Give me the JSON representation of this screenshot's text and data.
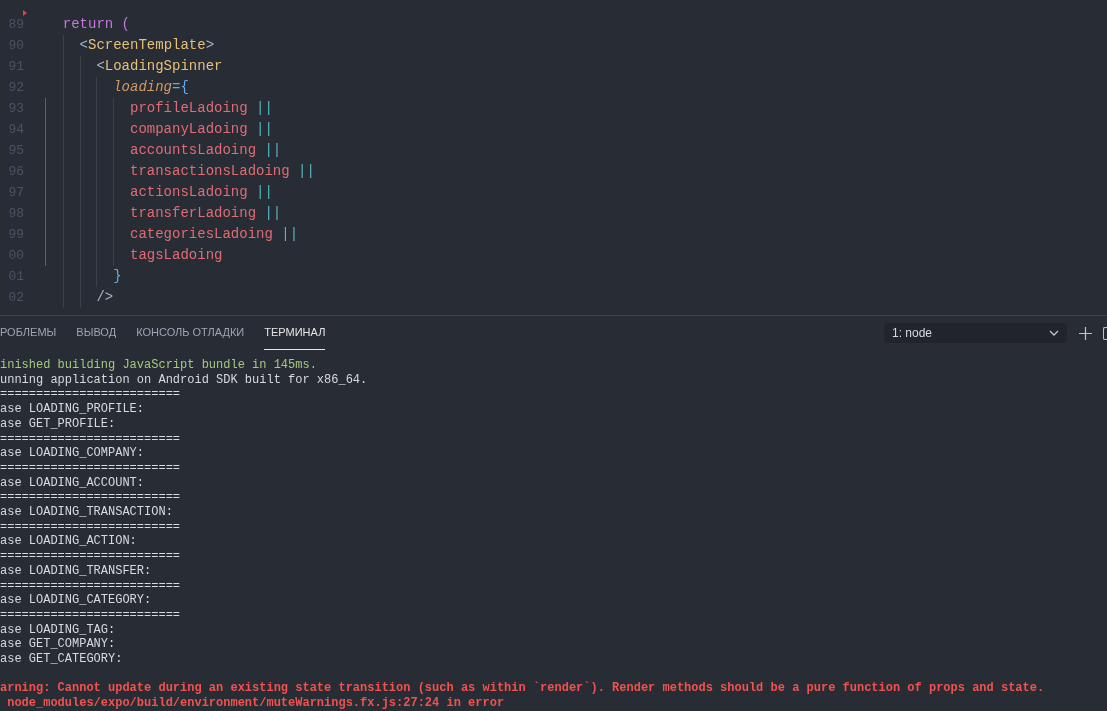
{
  "editor": {
    "fold_marker": true,
    "lines": [
      {
        "number": "89",
        "changed": false,
        "tokens": [
          {
            "text": "  return",
            "kind": "keyword"
          },
          {
            "text": " (",
            "kind": "paren"
          }
        ]
      },
      {
        "number": "90",
        "changed": false,
        "tokens": [
          {
            "text": "    <",
            "kind": "punct"
          },
          {
            "text": "ScreenTemplate",
            "kind": "tag"
          },
          {
            "text": ">",
            "kind": "punct"
          }
        ]
      },
      {
        "number": "91",
        "changed": false,
        "tokens": [
          {
            "text": "      <",
            "kind": "punct"
          },
          {
            "text": "LoadingSpinner",
            "kind": "tag"
          }
        ]
      },
      {
        "number": "92",
        "changed": false,
        "tokens": [
          {
            "text": "        loading",
            "kind": "attr"
          },
          {
            "text": "=",
            "kind": "operator"
          },
          {
            "text": "{",
            "kind": "brace"
          }
        ]
      },
      {
        "number": "93",
        "changed": true,
        "tokens": [
          {
            "text": "          profileLadoing",
            "kind": "ident"
          },
          {
            "text": " ||",
            "kind": "operator"
          }
        ]
      },
      {
        "number": "94",
        "changed": true,
        "tokens": [
          {
            "text": "          companyLadoing",
            "kind": "ident"
          },
          {
            "text": " ||",
            "kind": "operator"
          }
        ]
      },
      {
        "number": "95",
        "changed": true,
        "tokens": [
          {
            "text": "          accountsLadoing",
            "kind": "ident"
          },
          {
            "text": " ||",
            "kind": "operator"
          }
        ]
      },
      {
        "number": "96",
        "changed": true,
        "tokens": [
          {
            "text": "          transactionsLadoing",
            "kind": "ident"
          },
          {
            "text": " ||",
            "kind": "operator"
          }
        ]
      },
      {
        "number": "97",
        "changed": true,
        "tokens": [
          {
            "text": "          actionsLadoing",
            "kind": "ident"
          },
          {
            "text": " ||",
            "kind": "operator"
          }
        ]
      },
      {
        "number": "98",
        "changed": true,
        "tokens": [
          {
            "text": "          transferLadoing",
            "kind": "ident"
          },
          {
            "text": " ||",
            "kind": "operator"
          }
        ]
      },
      {
        "number": "99",
        "changed": true,
        "tokens": [
          {
            "text": "          categoriesLadoing",
            "kind": "ident"
          },
          {
            "text": " ||",
            "kind": "operator"
          }
        ]
      },
      {
        "number": "00",
        "changed": true,
        "tokens": [
          {
            "text": "          tagsLadoing",
            "kind": "ident"
          }
        ]
      },
      {
        "number": "01",
        "changed": false,
        "tokens": [
          {
            "text": "        }",
            "kind": "brace"
          }
        ]
      },
      {
        "number": "02",
        "changed": false,
        "tokens": [
          {
            "text": "      />",
            "kind": "punct"
          }
        ]
      }
    ]
  },
  "panel": {
    "tabs": [
      {
        "label": "РОБЛЕМЫ",
        "selected": false
      },
      {
        "label": "ВЫВОД",
        "selected": false
      },
      {
        "label": "КОНСОЛЬ ОТЛАДКИ",
        "selected": false
      },
      {
        "label": "ТЕРМИНАЛ",
        "selected": true
      }
    ],
    "terminal_select": {
      "value": "1: node"
    }
  },
  "terminal": {
    "lines": [
      {
        "text": "inished building JavaScript bundle in 145ms.",
        "kind": "success"
      },
      {
        "text": "unning application on Android SDK built for x86_64.",
        "kind": "normal"
      },
      {
        "text": "=========================",
        "kind": "normal"
      },
      {
        "text": "ase LOADING_PROFILE:",
        "kind": "normal"
      },
      {
        "text": "ase GET_PROFILE:",
        "kind": "normal"
      },
      {
        "text": "=========================",
        "kind": "normal"
      },
      {
        "text": "ase LOADING_COMPANY:",
        "kind": "normal"
      },
      {
        "text": "=========================",
        "kind": "normal"
      },
      {
        "text": "ase LOADING_ACCOUNT:",
        "kind": "normal"
      },
      {
        "text": "=========================",
        "kind": "normal"
      },
      {
        "text": "ase LOADING_TRANSACTION:",
        "kind": "normal"
      },
      {
        "text": "=========================",
        "kind": "normal"
      },
      {
        "text": "ase LOADING_ACTION:",
        "kind": "normal"
      },
      {
        "text": "=========================",
        "kind": "normal"
      },
      {
        "text": "ase LOADING_TRANSFER:",
        "kind": "normal"
      },
      {
        "text": "=========================",
        "kind": "normal"
      },
      {
        "text": "ase LOADING_CATEGORY:",
        "kind": "normal"
      },
      {
        "text": "=========================",
        "kind": "normal"
      },
      {
        "text": "ase LOADING_TAG:",
        "kind": "normal"
      },
      {
        "text": "ase GET_COMPANY:",
        "kind": "normal"
      },
      {
        "text": "ase GET_CATEGORY:",
        "kind": "normal"
      },
      {
        "text": "arning: Cannot update during an existing state transition (such as within `render`). Render methods should be a pure function of props and state.",
        "kind": "error"
      },
      {
        "text": " node_modules/expo/build/environment/muteWarnings.fx.js:27:24 in error",
        "kind": "error"
      }
    ]
  }
}
